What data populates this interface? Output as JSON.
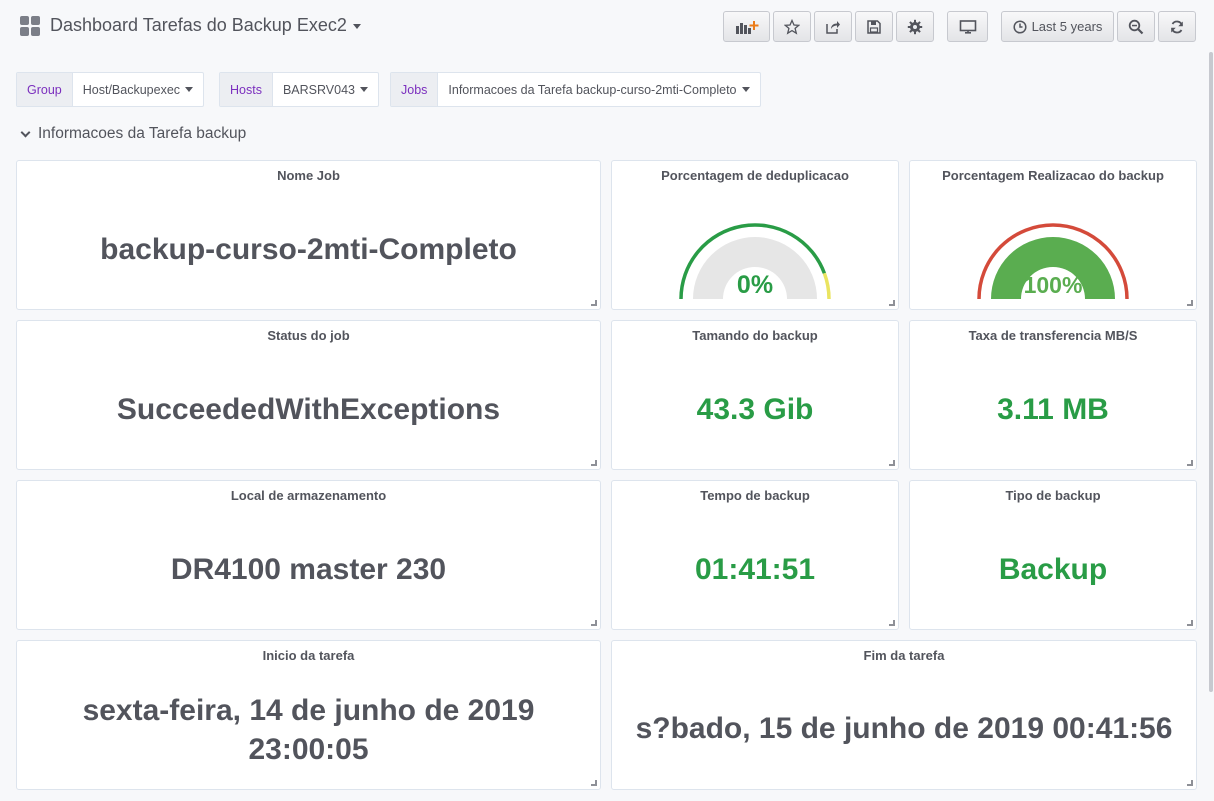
{
  "header": {
    "title": "Dashboard Tarefas do Backup Exec2",
    "time_range": "Last 5 years"
  },
  "variables": [
    {
      "label": "Group",
      "value": "Host/Backupexec"
    },
    {
      "label": "Hosts",
      "value": "BARSRV043"
    },
    {
      "label": "Jobs",
      "value": "Informacoes da Tarefa backup-curso-2mti-Completo"
    }
  ],
  "row": {
    "title": "Informacoes da Tarefa backup"
  },
  "panels": {
    "nome_job": {
      "title": "Nome Job",
      "value": "backup-curso-2mti-Completo"
    },
    "dedup": {
      "title": "Porcentagem de deduplicacao",
      "value": "0%",
      "percent": 0
    },
    "realizacao": {
      "title": "Porcentagem Realizacao do backup",
      "value": "100%",
      "percent": 100
    },
    "status": {
      "title": "Status do job",
      "value": "SucceededWithExceptions"
    },
    "tamanho": {
      "title": "Tamando do backup",
      "value": "43.3 Gib"
    },
    "taxa": {
      "title": "Taxa de transferencia MB/S",
      "value": "3.11 MB"
    },
    "local": {
      "title": "Local de armazenamento",
      "value": "DR4100 master 230"
    },
    "tempo": {
      "title": "Tempo de backup",
      "value": "01:41:51"
    },
    "tipo": {
      "title": "Tipo de backup",
      "value": "Backup"
    },
    "inicio": {
      "title": "Inicio da tarefa",
      "value": "sexta-feira, 14 de junho de 2019 23:00:05"
    },
    "fim": {
      "title": "Fim da tarefa",
      "value": "s?bado, 15 de junho de 2019 00:41:56"
    }
  },
  "colors": {
    "green": "#299c46",
    "gauge_green": "#5aad50",
    "red": "#d44a3a",
    "yellow": "#eae460",
    "purple_label": "#7b2fbe"
  }
}
